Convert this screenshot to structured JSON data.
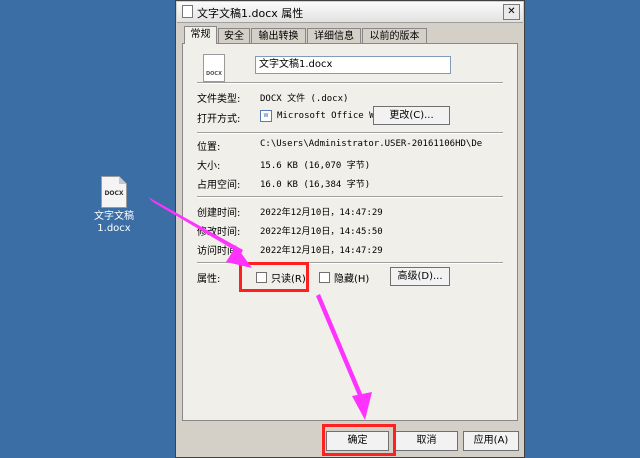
{
  "desktop": {
    "icon_badge": "DOCX",
    "icon_label_line1": "文字文稿",
    "icon_label_line2": "1.docx"
  },
  "window": {
    "title": "文字文稿1.docx 属性",
    "close_glyph": "✕"
  },
  "tabs": [
    "常规",
    "安全",
    "输出转换",
    "详细信息",
    "以前的版本"
  ],
  "general": {
    "doc_badge": "DOCX",
    "filename": "文字文稿1.docx",
    "file_type_label": "文件类型:",
    "file_type_value": "DOCX 文件 (.docx)",
    "open_with_label": "打开方式:",
    "open_with_value": "Microsoft Office Wo",
    "change_button": "更改(C)...",
    "location_label": "位置:",
    "location_value": "C:\\Users\\Administrator.USER-20161106HD\\De",
    "size_label": "大小:",
    "size_value": "15.6 KB (16,070 字节)",
    "disk_label": "占用空间:",
    "disk_value": "16.0 KB (16,384 字节)",
    "created_label": "创建时间:",
    "created_value": "2022年12月10日，14:47:29",
    "modified_label": "修改时间:",
    "modified_value": "2022年12月10日，14:45:50",
    "accessed_label": "访问时间:",
    "accessed_value": "2022年12月10日，14:47:29",
    "attributes_label": "属性:",
    "readonly_label": "只读(R)",
    "hidden_label": "隐藏(H)",
    "advanced_button": "高级(D)..."
  },
  "footer": {
    "ok": "确定",
    "cancel": "取消",
    "apply": "应用(A)"
  },
  "colors": {
    "desktop": "#3a6ea5",
    "highlight": "#ff2020",
    "arrow": "#ff33ff"
  }
}
